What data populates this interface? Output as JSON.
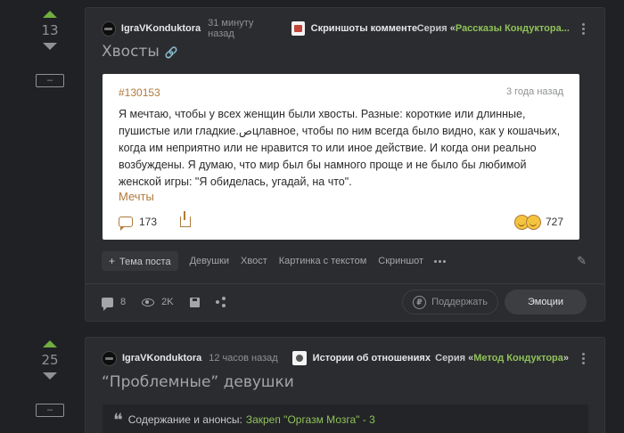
{
  "posts": [
    {
      "rating": "13",
      "minus_label": "–",
      "author": "IgraVKonduktora",
      "time": "31 минуту назад",
      "community": "Скриншоты комменте...",
      "series_prefix": "Серия «",
      "series_name": "Рассказы Кондуктора...",
      "title": "Хвосты",
      "card": {
        "id": "#130153",
        "time": "3 года назад",
        "text": "Я мечтаю, чтобы у всех женщин были хвосты. Разные: короткие или длинные, пушистые или гладкие.صцлавное, чтобы по ним всегда было видно, как у кошачьих, когда им неприятно или не нравится то или иное действие. И когда они реально возбуждены. Я думаю, что мир был бы намного проще и не было бы любимой женской игры: \"Я обиделась, угадай, на что\".",
        "tag": "Мечты",
        "comments": "173",
        "reactions": "727"
      },
      "tags": {
        "main": "Тема поста",
        "plus": "+",
        "items": [
          "Девушки",
          "Хвост",
          "Картинка с текстом",
          "Скриншот"
        ]
      },
      "actions": {
        "comments": "8",
        "views": "2K",
        "support": "Поддержать",
        "support_icon": "₽",
        "emotions": "Эмоции"
      }
    },
    {
      "rating": "25",
      "minus_label": "–",
      "author": "IgraVKonduktora",
      "time": "12 часов назад",
      "community": "Истории об отношениях",
      "series_prefix": "Серия «",
      "series_name": "Метод Кондуктора",
      "series_suffix": "»",
      "title": "“Проблемные” девушки",
      "quote_text": "Содержание и анонсы:",
      "quote_link": "Закреп \"Оргазм Мозга\" - 3"
    }
  ],
  "colors": {
    "accent_green": "#8fc25a",
    "accent_orange": "#b07a3a",
    "upvote": "#6fae3f"
  }
}
